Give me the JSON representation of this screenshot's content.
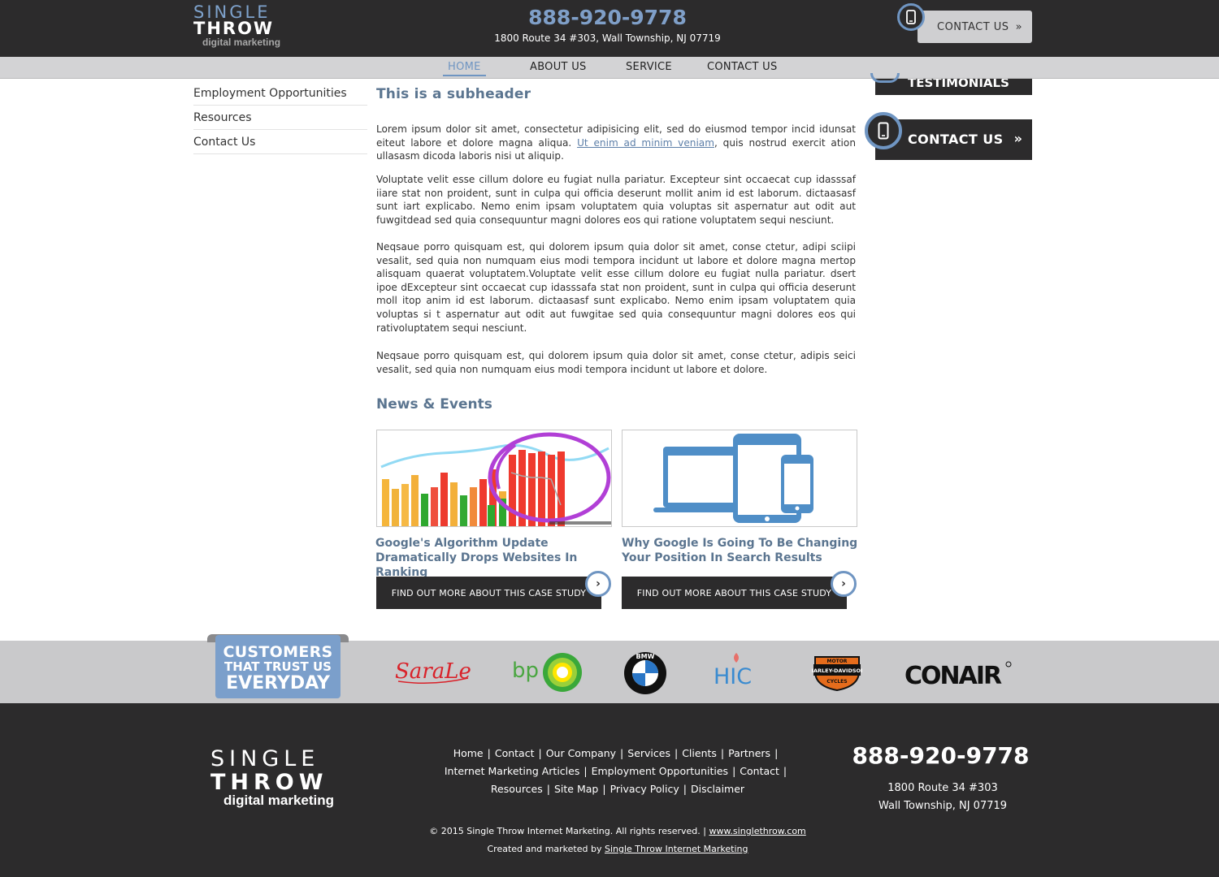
{
  "header": {
    "logo": {
      "line1": "SINGLE",
      "line2": "THROW",
      "line3": "digital marketing"
    },
    "phone": "888-920-9778",
    "address": "1800 Route 34 #303, Wall Township, NJ 07719",
    "contact_button": "CONTACT US"
  },
  "nav": {
    "items": [
      {
        "label": "HOME",
        "active": true
      },
      {
        "label": "ABOUT US"
      },
      {
        "label": "SERVICE"
      },
      {
        "label": "CONTACT US"
      }
    ]
  },
  "sidebar": {
    "items": [
      {
        "label": "Employment Opportunities"
      },
      {
        "label": "Resources"
      },
      {
        "label": "Contact Us"
      }
    ]
  },
  "right_sidebar": {
    "testimonials_label": "TESTIMONIALS",
    "contact_label": "CONTACT US"
  },
  "main": {
    "subheader": "This is a subheader",
    "paragraphs": [
      {
        "before_link": "Lorem ipsum dolor sit amet, consectetur adipisicing elit, sed do eiusmod tempor incid idunsat eiteut labore et dolore magna aliqua. ",
        "link": "Ut enim ad minim veniam",
        "after_link": ", quis nostrud exercit ation ullasasm dicoda laboris nisi ut aliquip."
      },
      {
        "text": "Voluptate velit esse cillum dolore eu fugiat nulla pariatur. Excepteur sint occaecat cup idasssaf iiare stat non proident, sunt in culpa qui officia deserunt mollit anim id est laborum. dictaasasf sunt iart explicabo. Nemo enim ipsam voluptatem quia voluptas sit aspernatur aut odit aut fuwgitdead sed quia consequuntur magni dolores eos qui ratione voluptatem sequi nesciunt."
      },
      {
        "text": "Neqsaue porro quisquam est, qui dolorem ipsum quia dolor sit amet, conse ctetur, adipi sciipi vesalit, sed quia non numquam eius modi tempora incidunt ut labore et dolore magna mertop alisquam quaerat voluptatem.Voluptate velit esse cillum dolore eu fugiat nulla pariatur. dsert ipoe dExcepteur sint occaecat cup idasssafa stat non proident, sunt in culpa qui officia deserunt moll itop anim id est laborum. dictaasasf sunt explicabo. Nemo enim ipsam voluptatem quia voluptas si t aspernatur aut odit aut fuwgitae sed quia consequuntur magni dolores eos qui rativoluptatem sequi nesciunt."
      },
      {
        "text": "Neqsaue porro quisquam est, qui dolorem ipsum quia dolor sit amet, conse ctetur, adipis seici vesalit, sed quia non numquam eius modi tempora incidunt ut labore et dolore."
      }
    ],
    "news_title": "News & Events",
    "news": [
      {
        "title": "Google's Algorithm Update Dramatically Drops Websites In Ranking",
        "button": "FIND OUT MORE ABOUT THIS CASE STUDY"
      },
      {
        "title": "Why Google Is Going To Be Changing Your Position In Search Results",
        "button": "FIND OUT MORE ABOUT THIS CASE STUDY"
      }
    ]
  },
  "customers": {
    "badge_line1": "CUSTOMERS",
    "badge_line2": "THAT TRUST US",
    "badge_line3": "EVERYDAY",
    "logos": [
      "Sara Lee",
      "bp",
      "BMW",
      "HIC",
      "Harley-Davidson",
      "CONAIR"
    ],
    "logo_text": {
      "saralee": "SaraLee",
      "bp": "bp",
      "bmw": "BMW",
      "hic": "HIC",
      "harley": [
        "MOTOR",
        "HARLEY-DAVIDSON",
        "CYCLES"
      ],
      "conair": "CONAIR"
    }
  },
  "footer": {
    "logo": {
      "line1": "SINGLE",
      "line2": "THROW",
      "line3": "digital marketing"
    },
    "links_row1": [
      "Home",
      "Contact",
      "Our Company",
      "Services",
      "Clients",
      "Partners"
    ],
    "links_row2": [
      "Internet Marketing Articles",
      "Employment Opportunities",
      "Contact"
    ],
    "links_row3": [
      "Resources",
      "Site Map",
      "Privacy Policy",
      "Disclaimer"
    ],
    "phone": "888-920-9778",
    "address_line1": "1800 Route 34 #303",
    "address_line2": "Wall Township, NJ 07719",
    "copyright": "© 2015 Single Throw Internet Marketing. All rights reserved.",
    "copyright_link": "www.singlethrow.com",
    "created_prefix": "Created and marketed by",
    "created_link": "Single Throw Internet Marketing"
  },
  "colors": {
    "dark": "#2c2b2c",
    "accent_blue": "#6f95c2",
    "nav_gray": "#d3d3d5",
    "strip_gray": "#c9c9cb",
    "heading_blue": "#5b7590"
  },
  "icons": [
    "mobile-phone-icon",
    "chevron-double-right-icon",
    "chevron-right-icon"
  ]
}
